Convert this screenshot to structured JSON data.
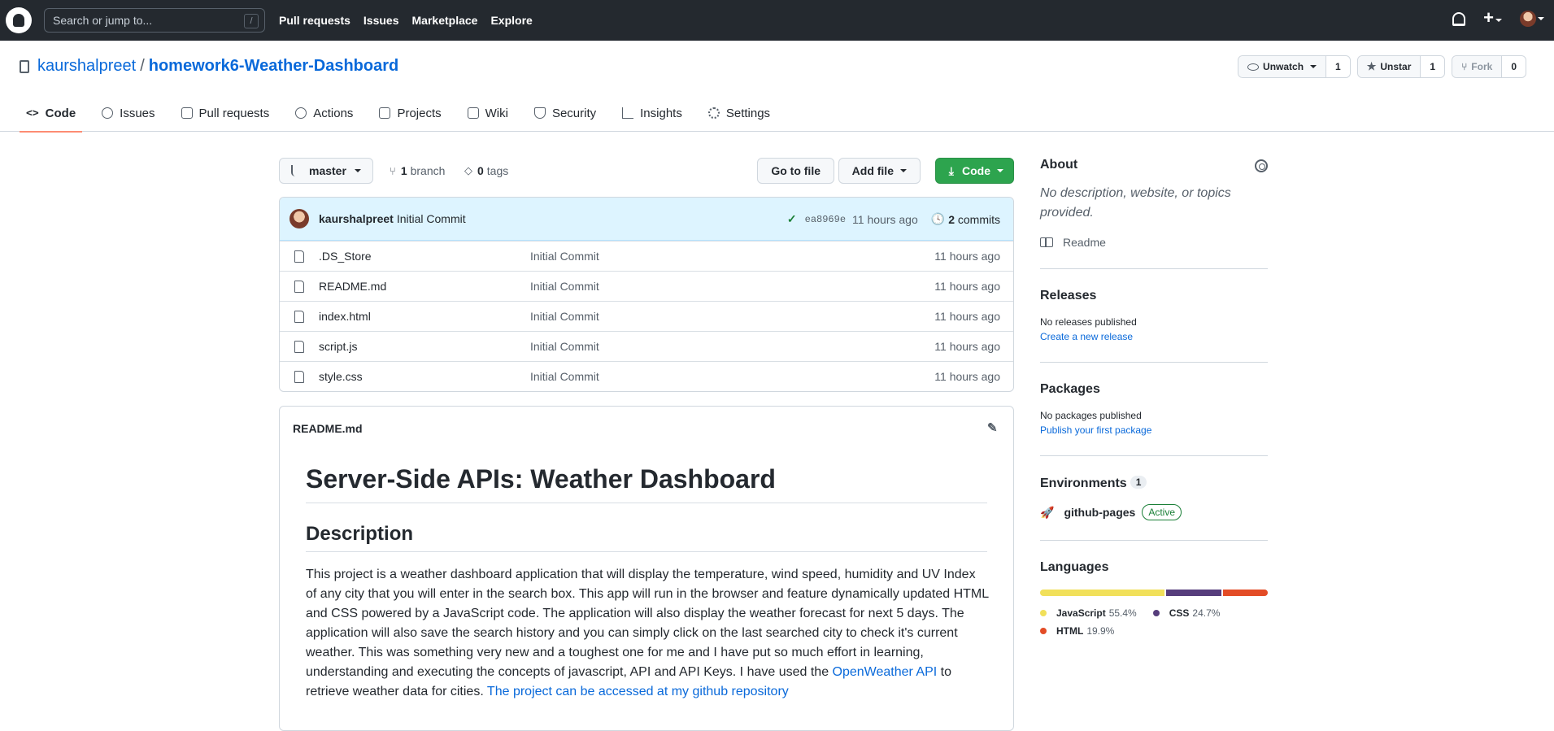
{
  "header": {
    "search_placeholder": "Search or jump to...",
    "search_shortcut": "/",
    "nav": [
      "Pull requests",
      "Issues",
      "Marketplace",
      "Explore"
    ]
  },
  "repo": {
    "owner": "kaurshalpreet",
    "separator": "/",
    "name": "homework6-Weather-Dashboard",
    "watch_label": "Unwatch",
    "watch_count": "1",
    "star_label": "Unstar",
    "star_count": "1",
    "fork_label": "Fork",
    "fork_count": "0"
  },
  "tabs": [
    {
      "label": "Code",
      "icon": "code-icon",
      "active": true
    },
    {
      "label": "Issues",
      "icon": "issue-icon"
    },
    {
      "label": "Pull requests",
      "icon": "pull-request-icon"
    },
    {
      "label": "Actions",
      "icon": "play-icon"
    },
    {
      "label": "Projects",
      "icon": "project-icon"
    },
    {
      "label": "Wiki",
      "icon": "book-icon"
    },
    {
      "label": "Security",
      "icon": "shield-icon"
    },
    {
      "label": "Insights",
      "icon": "graph-icon"
    },
    {
      "label": "Settings",
      "icon": "gear-icon"
    }
  ],
  "branchbar": {
    "branch": "master",
    "branch_count": "1",
    "branch_word": "branch",
    "tag_count": "0",
    "tag_word": "tags",
    "goto_label": "Go to file",
    "add_label": "Add file",
    "code_label": "Code"
  },
  "commit": {
    "author": "kaurshalpreet",
    "message": "Initial Commit",
    "sha": "ea8969e",
    "time": "11 hours ago",
    "commit_count": "2",
    "commit_word": "commits"
  },
  "files": [
    {
      "name": ".DS_Store",
      "message": "Initial Commit",
      "time": "11 hours ago"
    },
    {
      "name": "README.md",
      "message": "Initial Commit",
      "time": "11 hours ago"
    },
    {
      "name": "index.html",
      "message": "Initial Commit",
      "time": "11 hours ago"
    },
    {
      "name": "script.js",
      "message": "Initial Commit",
      "time": "11 hours ago"
    },
    {
      "name": "style.css",
      "message": "Initial Commit",
      "time": "11 hours ago"
    }
  ],
  "readme": {
    "filename": "README.md",
    "h1": "Server-Side APIs: Weather Dashboard",
    "h2": "Description",
    "paragraph": "This project is a weather dashboard application that will display the temperature, wind speed, humidity and UV Index of any city that you will enter in the search box. This app will run in the browser and feature dynamically updated HTML and CSS powered by a JavaScript code. The application will also display the weather forecast for next 5 days. The application will also save the search history and you can simply click on the last searched city to check it's current weather. This was something very new and a toughest one for me and I have put so much effort in learning, understanding and executing the concepts of javascript, API and API Keys. I have used the ",
    "link1": "OpenWeather API",
    "middle": " to retrieve weather data for cities. ",
    "link2": "The project can be accessed at my github repository"
  },
  "sidebar": {
    "about_title": "About",
    "about_desc": "No description, website, or topics provided.",
    "readme_label": "Readme",
    "releases_title": "Releases",
    "releases_none": "No releases published",
    "releases_link": "Create a new release",
    "packages_title": "Packages",
    "packages_none": "No packages published",
    "packages_link": "Publish your first package",
    "env_title": "Environments",
    "env_count": "1",
    "env_name": "github-pages",
    "env_status": "Active",
    "lang_title": "Languages",
    "languages": [
      {
        "name": "JavaScript",
        "pct": "55.4%",
        "value": 55.4,
        "color": "#f1e05a"
      },
      {
        "name": "CSS",
        "pct": "24.7%",
        "value": 24.7,
        "color": "#563d7c"
      },
      {
        "name": "HTML",
        "pct": "19.9%",
        "value": 19.9,
        "color": "#e34c26"
      }
    ]
  }
}
